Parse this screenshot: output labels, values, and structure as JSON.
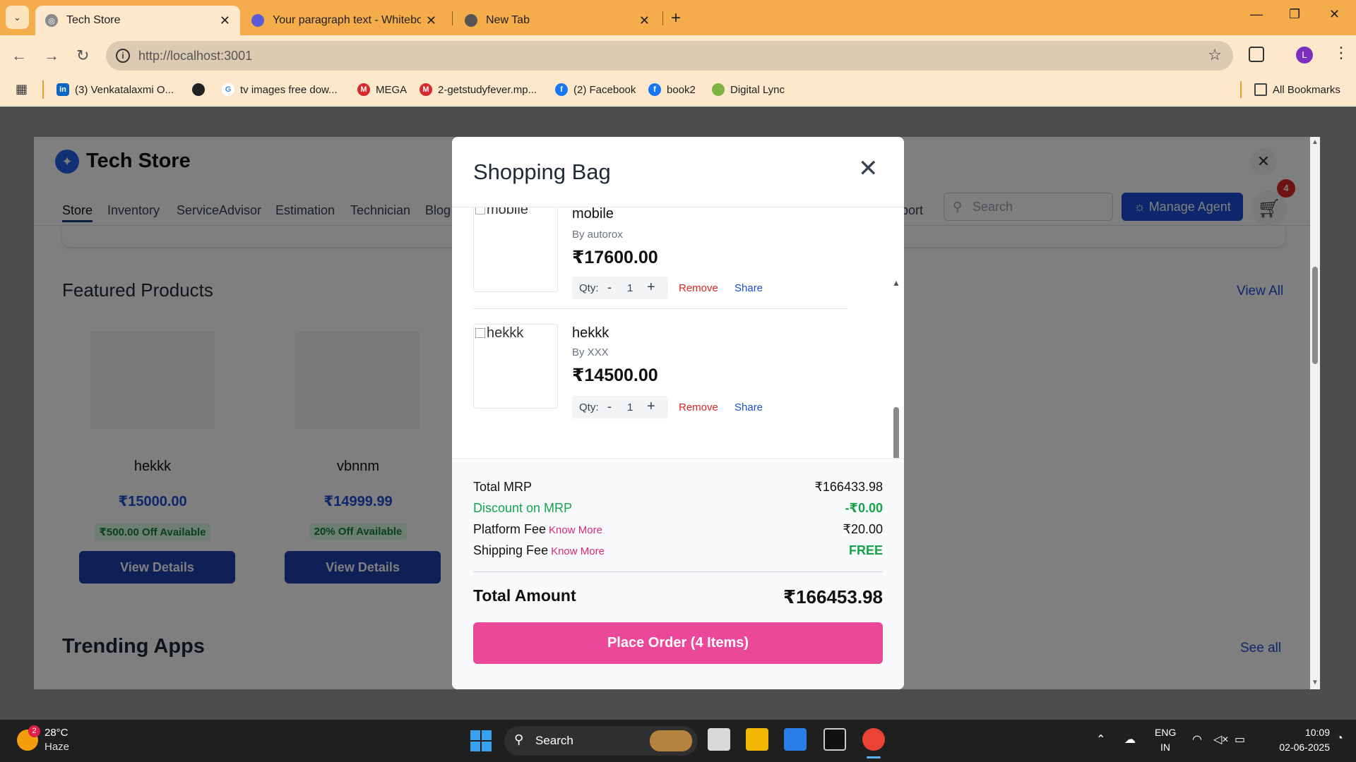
{
  "browser": {
    "tabs": [
      {
        "title": "Tech Store",
        "active": true
      },
      {
        "title": "Your paragraph text - Whiteboa",
        "active": false
      },
      {
        "title": "New Tab",
        "active": false
      }
    ],
    "url": "http://localhost:3001",
    "profile_initial": "L",
    "bookmarks": [
      "(3) Venkatalaxmi O...",
      "tv images free dow...",
      "MEGA",
      "2-getstudyfever.mp...",
      "(2) Facebook",
      "book2",
      "Digital Lync"
    ],
    "all_bookmarks": "All Bookmarks"
  },
  "store": {
    "brand": "Tech Store",
    "nav": [
      "Store",
      "Inventory",
      "ServiceAdvisor",
      "Estimation",
      "Technician",
      "Blog",
      "port"
    ],
    "search_placeholder": "Search",
    "manage_agent": "Manage Agent",
    "cart_count": "4",
    "featured_title": "Featured Products",
    "view_all": "View All",
    "products": [
      {
        "name": "hekkk",
        "price": "₹15000.00",
        "offer": "₹500.00 Off Available",
        "button": "View Details"
      },
      {
        "name": "vbnnm",
        "price": "₹14999.99",
        "offer": "20% Off Available",
        "button": "View Details"
      }
    ],
    "trending_title": "Trending Apps",
    "see_all": "See all"
  },
  "bag": {
    "title": "Shopping Bag",
    "items": [
      {
        "img_alt": "mobile",
        "name": "mobile",
        "by": "By autorox",
        "price": "₹17600.00",
        "qty_label": "Qty:",
        "qty": "1",
        "remove": "Remove",
        "share": "Share"
      },
      {
        "img_alt": "hekkk",
        "name": "hekkk",
        "by": "By XXX",
        "price": "₹14500.00",
        "qty_label": "Qty:",
        "qty": "1",
        "remove": "Remove",
        "share": "Share"
      }
    ],
    "summary": {
      "total_mrp_label": "Total MRP",
      "total_mrp": "₹166433.98",
      "discount_label": "Discount on MRP",
      "discount": "-₹0.00",
      "platform_label": "Platform Fee",
      "platform_fee": "₹20.00",
      "shipping_label": "Shipping Fee",
      "shipping_fee": "FREE",
      "know_more": "Know More",
      "total_label": "Total Amount",
      "total": "₹166453.98"
    },
    "place_order": "Place Order (4 Items)"
  },
  "taskbar": {
    "weather_temp": "28°C",
    "weather_desc": "Haze",
    "weather_badge": "2",
    "search": "Search",
    "lang_top": "ENG",
    "lang_bottom": "IN",
    "time": "10:09",
    "date": "02-06-2025"
  },
  "colors": {
    "tabbar": "#f5ad4c",
    "primary_blue": "#1d4ed8",
    "place_order_pink": "#ec4899",
    "remove_red": "#dc2626",
    "discount_green": "#16a34a"
  }
}
